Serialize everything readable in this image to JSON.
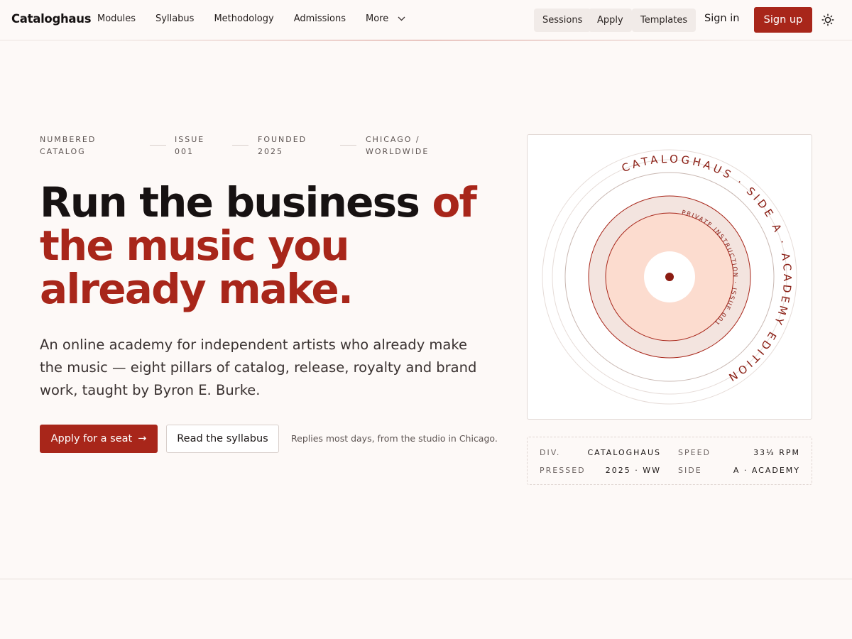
{
  "brand": {
    "name": "Cataloghaus",
    "accent": "#a8261a"
  },
  "nav": {
    "links": [
      "Modules",
      "Syllabus",
      "Methodology",
      "Admissions"
    ],
    "more_label": "More",
    "pills": [
      "Sessions",
      "Apply",
      "Templates"
    ],
    "sign_in": "Sign in",
    "sign_up": "Sign up",
    "theme_icon": "sun-icon"
  },
  "hero": {
    "meta": [
      "NUMBERED\nCATALOG",
      "ISSUE\n001",
      "FOUNDED\n2025",
      "CHICAGO /\nWORLDWIDE"
    ],
    "headline_plain": "Run the business ",
    "headline_accent": "of the music you already make.",
    "lede": "An online academy for independent artists who already make the music — eight pillars of catalog, release, royalty and brand work, taught by Byron E. Burke.",
    "primary_cta": "Apply for a seat",
    "primary_cta_arrow": "→",
    "secondary_cta": "Read the syllabus",
    "reply_note": "Replies most days, from the studio in Chicago."
  },
  "record": {
    "outer_text": "CATALOGHAUS · SIDE A · ACADEMY EDITION",
    "label_text": "PRIVATE INSTRUCTION · ISSUE 001"
  },
  "specs": {
    "div_label": "DIV.",
    "div_value": "CATALOGHAUS",
    "speed_label": "SPEED",
    "speed_value": "33⅓ RPM",
    "pressed_label": "PRESSED",
    "pressed_value": "2025 · WW",
    "side_label": "SIDE",
    "side_value": "A · ACADEMY"
  }
}
